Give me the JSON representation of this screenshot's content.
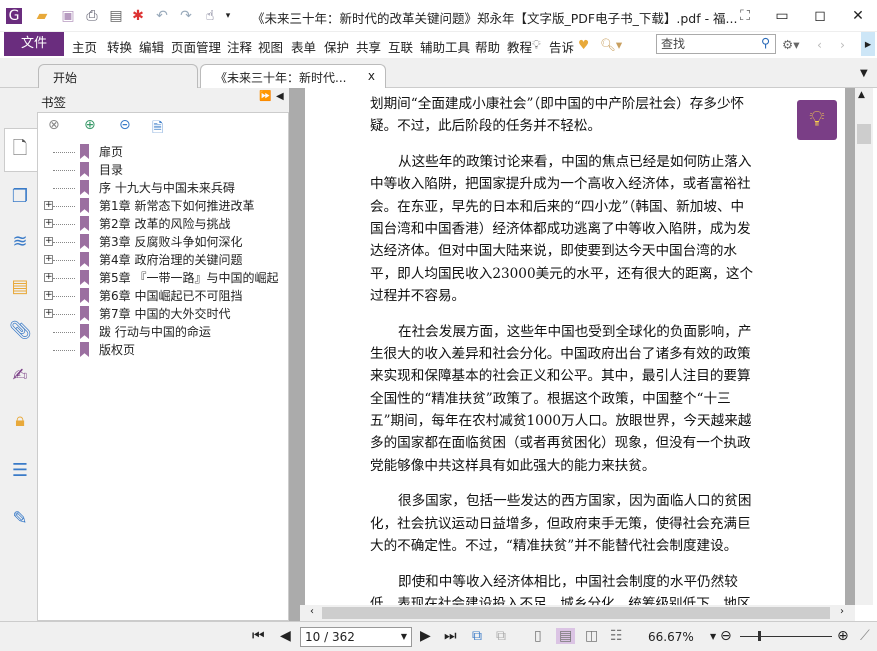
{
  "title": "《未来三十年：新时代的改革关键问题》郑永年【文字版_PDF电子书_下载】.pdf - 福...",
  "menu": {
    "file": "文件",
    "items": [
      "主页",
      "转换",
      "编辑",
      "页面管理",
      "注释",
      "视图",
      "表单",
      "保护",
      "共享",
      "互联",
      "辅助工具",
      "帮助",
      "教程"
    ],
    "tell": "告诉",
    "search_placeholder": "查找"
  },
  "tabs": [
    {
      "label": "开始"
    },
    {
      "label": "《未来三十年：新时代...",
      "close": "x"
    }
  ],
  "bookmarks": {
    "title": "书签",
    "items": [
      {
        "label": "扉页",
        "expandable": false
      },
      {
        "label": "目录",
        "expandable": false
      },
      {
        "label": "序 十九大与中国未来兵碍",
        "expandable": false
      },
      {
        "label": "第1章 新常态下如何推进改革",
        "expandable": true
      },
      {
        "label": "第2章 改革的风险与挑战",
        "expandable": true
      },
      {
        "label": "第3章 反腐败斗争如何深化",
        "expandable": true
      },
      {
        "label": "第4章 政府治理的关键问题",
        "expandable": true
      },
      {
        "label": "第5章 『一带一路』与中国的崛起",
        "expandable": true
      },
      {
        "label": "第6章 中国崛起已不可阻挡",
        "expandable": true
      },
      {
        "label": "第7章 中国的大外交时代",
        "expandable": true
      },
      {
        "label": "跋 行动与中国的命运",
        "expandable": false
      },
      {
        "label": "版权页",
        "expandable": false
      }
    ]
  },
  "document": {
    "paragraphs": [
      {
        "indent": false,
        "lines": [
          "划期间“全面建成小康社会”（即中国的中产阶层社会）存多少怀",
          "疑。不过，此后阶段的任务并不轻松。"
        ]
      },
      {
        "indent": true,
        "lines": [
          "从这些年的政策讨论来看，中国的焦点已经是如何防止落入",
          "中等收入陷阱，把国家提升成为一个高收入经济体，或者富裕社",
          "会。在东亚，早先的日本和后来的“四小龙”（韩国、新加坡、中",
          "国台湾和中国香港）经济体都成功逃离了中等收入陷阱，成为发",
          "达经济体。但对中国大陆来说，即使要到达今天中国台湾的水",
          "平，即人均国民收入23000美元的水平，还有很大的距离，这个",
          "过程并不容易。"
        ]
      },
      {
        "indent": true,
        "lines": [
          "在社会发展方面，这些年中国也受到全球化的负面影响，产",
          "生很大的收入差异和社会分化。中国政府出台了诸多有效的政策",
          "来实现和保障基本的社会正义和公平。其中，最引人注目的要算",
          "全国性的“精准扶贫”政策了。根据这个政策，中国整个“十三",
          "五”期间，每年在农村减贫1000万人口。放眼世界，今天越来越",
          "多的国家都在面临贫困（或者再贫困化）现象，但没有一个执政",
          "党能够像中共这样具有如此强大的能力来扶贫。"
        ]
      },
      {
        "indent": true,
        "lines": [
          "很多国家，包括一些发达的西方国家，因为面临人口的贫困",
          "化，社会抗议运动日益增多，但政府束手无策，使得社会充满巨",
          "大的不确定性。不过，“精准扶贫”并不能替代社会制度建设。"
        ]
      },
      {
        "indent": true,
        "lines": [
          "即使和中等收入经济体相比，中国社会制度的水平仍然较",
          "低，表现在社会建设投入不足、城乡分化、统筹级别低下、地区"
        ]
      }
    ]
  },
  "status": {
    "page": "10 / 362",
    "zoom": "66.67%",
    "zoom_slider_fraction": 0.5
  },
  "colors": {
    "brand": "#6a2d7e",
    "bookmark": "#9b6fa0"
  }
}
